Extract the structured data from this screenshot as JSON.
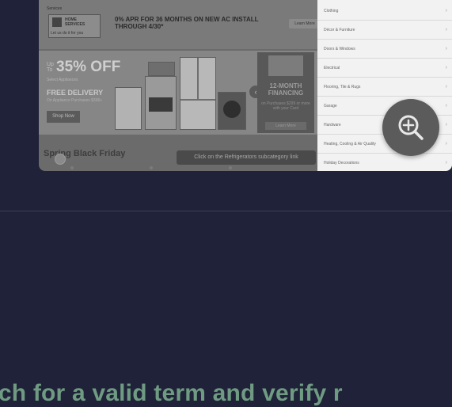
{
  "site": {
    "logo_line1": "HOME\nSERVICES",
    "logo_line2": "Let us do it for you",
    "top_tiny": "Services",
    "promo": "0% APR FOR 36 MONTHS ON NEW AC INSTALL\nTHROUGH 4/30*",
    "learn_more": "Learn More"
  },
  "hero": {
    "pct_prefix": "Up To",
    "pct": "35% OFF",
    "pct_sub": "Select Appliances",
    "free": "FREE DELIVERY",
    "free_sub": "On Appliance Purchases $396+",
    "shop_now": "Shop Now",
    "fin_title": "12-MONTH\nFINANCING",
    "fin_sub": "on Purchases $299 or more with your Card",
    "fin_btn": "Learn More",
    "arrow": "‹"
  },
  "section_title": "Spring Black Friday",
  "tooltip": "Click on the Refrigerators subcategory link",
  "menu": {
    "items": [
      {
        "label": "Clothing"
      },
      {
        "label": "Décor & Furniture"
      },
      {
        "label": "Doors & Windows"
      },
      {
        "label": "Electrical"
      },
      {
        "label": "Flooring, Tile & Rugs"
      },
      {
        "label": "Garage"
      },
      {
        "label": "Hardware"
      },
      {
        "label": "Heating, Cooling & Air Quality"
      },
      {
        "label": "Holiday Decorations"
      }
    ]
  },
  "zoom": {
    "icon": "zoom-in-icon"
  },
  "caption": "rch for a valid term and verify r"
}
